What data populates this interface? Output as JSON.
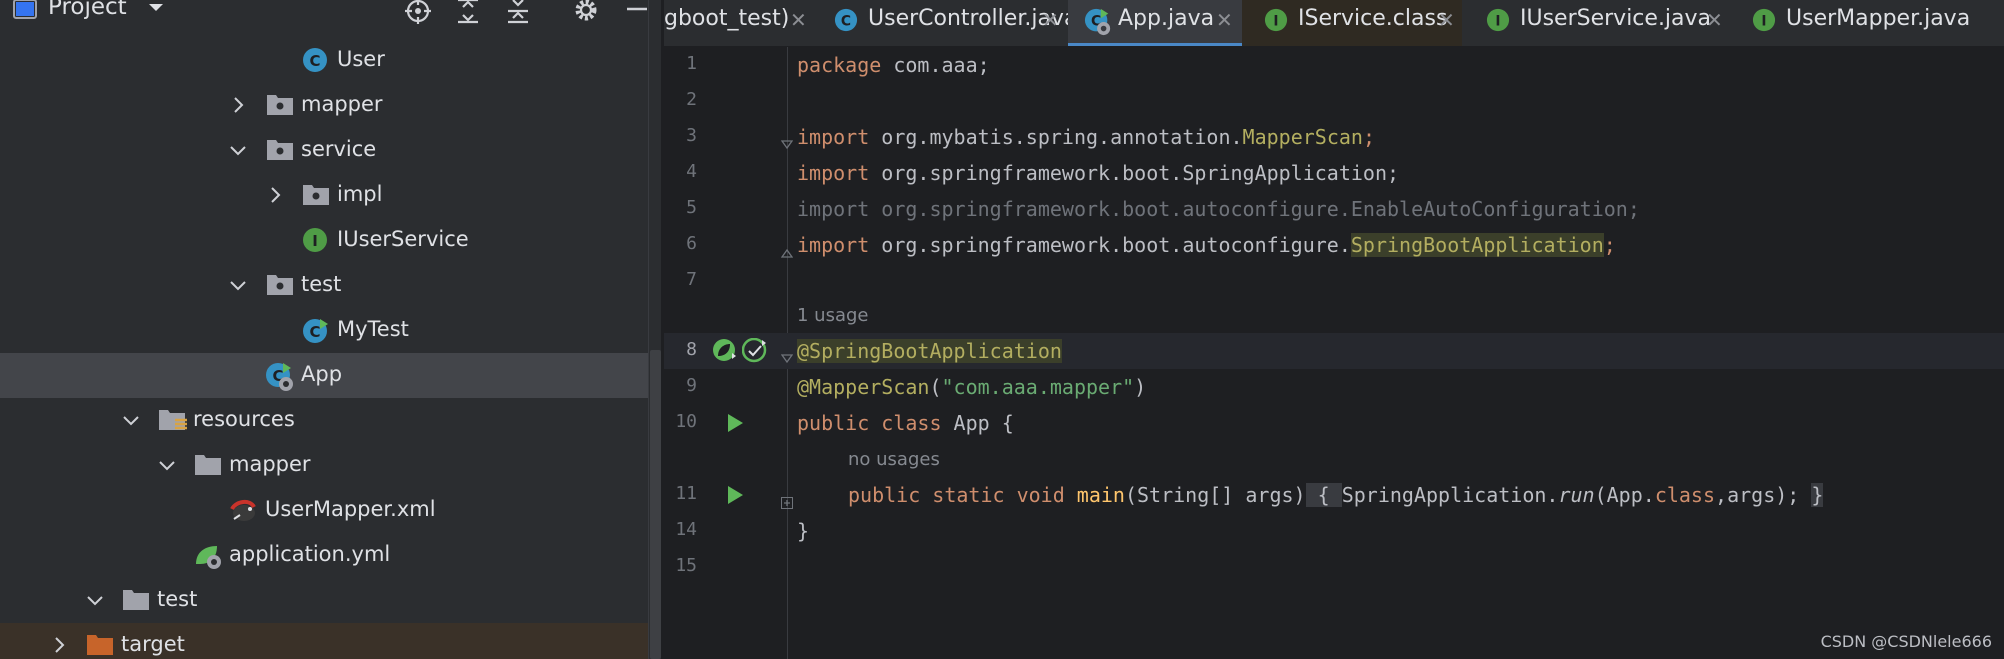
{
  "colors": {
    "panel_bg": "#2b2d30",
    "editor_bg": "#1e1f22",
    "selection": "#43454a",
    "keyword": "#cf8e6d",
    "annotation": "#b3ae60",
    "string": "#6aab73",
    "method": "#ffc66d",
    "class_icon": "#3592c4",
    "interface_icon": "#4f9c46",
    "folder_icon": "#a1a3ab",
    "excluded_folder": "#c7642a"
  },
  "project": {
    "title": "Project",
    "header_icons": [
      "locate-icon",
      "expand-all-icon",
      "collapse-all-icon",
      "settings-gear-icon",
      "minimize-icon"
    ],
    "tree": [
      {
        "label": "User",
        "icon": "class-icon",
        "arrow": "none"
      },
      {
        "label": "mapper",
        "icon": "package-folder-icon",
        "arrow": "collapsed"
      },
      {
        "label": "service",
        "icon": "package-folder-icon",
        "arrow": "expanded"
      },
      {
        "label": "impl",
        "icon": "package-folder-icon",
        "arrow": "collapsed"
      },
      {
        "label": "IUserService",
        "icon": "interface-icon",
        "arrow": "none"
      },
      {
        "label": "test",
        "icon": "package-folder-icon",
        "arrow": "expanded"
      },
      {
        "label": "MyTest",
        "icon": "runnable-class-icon",
        "arrow": "none"
      },
      {
        "label": "App",
        "icon": "spring-boot-app-icon",
        "arrow": "none",
        "selected": true
      },
      {
        "label": "resources",
        "icon": "resources-folder-icon",
        "arrow": "expanded"
      },
      {
        "label": "mapper",
        "icon": "folder-icon",
        "arrow": "expanded"
      },
      {
        "label": "UserMapper.xml",
        "icon": "mybatis-xml-icon",
        "arrow": "none"
      },
      {
        "label": "application.yml",
        "icon": "spring-yml-icon",
        "arrow": "none"
      },
      {
        "label": "test",
        "icon": "folder-icon",
        "arrow": "expanded"
      },
      {
        "label": "target",
        "icon": "excluded-folder-icon",
        "arrow": "collapsed",
        "excluded": true
      }
    ]
  },
  "tabs": [
    {
      "label": "gboot_test)",
      "icon": "none",
      "active": false
    },
    {
      "label": "UserController.java",
      "icon": "class-icon",
      "active": false
    },
    {
      "label": "App.java",
      "icon": "spring-boot-app-icon",
      "active": true
    },
    {
      "label": "IService.class",
      "icon": "interface-icon",
      "active": false
    },
    {
      "label": "IUserService.java",
      "icon": "interface-icon",
      "active": false
    },
    {
      "label": "UserMapper.java",
      "icon": "interface-icon",
      "active": false
    }
  ],
  "editor": {
    "line_numbers": [
      "1",
      "2",
      "3",
      "4",
      "5",
      "6",
      "7",
      "8",
      "9",
      "10",
      "11",
      "14",
      "15"
    ],
    "inlay_hints": {
      "usage": "1 usage",
      "no_usages": "no usages"
    },
    "code": {
      "l1_kw": "package",
      "l1_rest": " com.aaa;",
      "l3_kw": "import",
      "l3_pkg": " org.mybatis.spring.annotation.",
      "l3_cls": "MapperScan",
      "l3_end": ";",
      "l4_kw": "import",
      "l4_rest": " org.springframework.boot.SpringApplication;",
      "l5_text": "import org.springframework.boot.autoconfigure.EnableAutoConfiguration;",
      "l6_kw": "import",
      "l6_pkg": " org.springframework.boot.autoconfigure.",
      "l6_cls": "SpringBootApplication",
      "l6_end": ";",
      "l8_at": "@",
      "l8_anno": "SpringBootApplication",
      "l9_at": "@",
      "l9_anno": "MapperScan",
      "l9_open": "(",
      "l9_str": "\"com.aaa.mapper\"",
      "l9_close": ")",
      "l10_kw": "public class",
      "l10_rest": " App {",
      "l11_kw": "public static void",
      "l11_name": "main",
      "l11_params": "(String[] args)",
      "l11_brace_open": " { ",
      "l11_cls": "SpringApplication.",
      "l11_run": "run",
      "l11_args_a": "(App.",
      "l11_classkw": "class",
      "l11_args_b": ",args); ",
      "l11_brace_close": "}",
      "l14_text": "}"
    }
  },
  "watermark": "CSDN @CSDNlele666"
}
